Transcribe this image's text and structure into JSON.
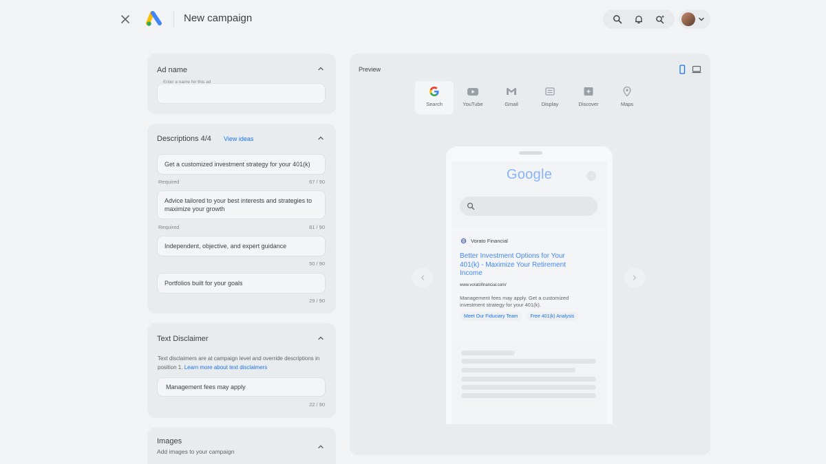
{
  "header": {
    "title": "New campaign"
  },
  "ad_name": {
    "title": "Ad name",
    "placeholder": "Enter a name for this ad"
  },
  "descriptions": {
    "title": "Descriptions 4/4",
    "view_ideas": "View ideas",
    "items": [
      {
        "text": "Get a customized investment strategy for your 401(k)",
        "helper": "Required",
        "count": "67 / 90"
      },
      {
        "text": "Advice tailored to your best interests and strategies to maximize your growth",
        "helper": "Required",
        "count": "81 / 90"
      },
      {
        "text": "Independent, objective, and expert guidance",
        "helper": "",
        "count": "50 / 90"
      },
      {
        "text": "Portfolios built for your goals",
        "helper": "",
        "count": "29 / 90"
      }
    ]
  },
  "text_disclaimer": {
    "title": "Text Disclaimer",
    "body_prefix": "Text disclaimers are at campaign level and override descriptions in position 1.",
    "learn_more": "Learn more about text disclaimers",
    "field_value": "Management fees may apply",
    "count": "22 / 90"
  },
  "images": {
    "title": "Images",
    "subtitle": "Add images to your campaign"
  },
  "preview": {
    "label": "Preview",
    "tabs": [
      {
        "label": "Search",
        "icon": "google-g-icon"
      },
      {
        "label": "YouTube",
        "icon": "youtube-icon"
      },
      {
        "label": "Gmail",
        "icon": "gmail-icon"
      },
      {
        "label": "Display",
        "icon": "display-icon"
      },
      {
        "label": "Discover",
        "icon": "discover-icon"
      },
      {
        "label": "Maps",
        "icon": "maps-pin-icon"
      }
    ],
    "active_tab": "Search",
    "phone": {
      "google_word": "Google",
      "advertiser": "Vorato Financial",
      "headline": "Better Investment Options for Your 401(k) - Maximize Your Retirement Income",
      "url": "www.voratofinancial.com/",
      "description": "Management fees may apply. Get a customized investment strategy for your 401(k).",
      "sitelinks": [
        "Meet Our Fiduciary Team",
        "Free 401(k) Analysis"
      ]
    }
  },
  "colors": {
    "background": "#f1f3f5",
    "card": "#e9ecef",
    "accent_blue": "#1a73e8",
    "headline_blue": "#4285f4"
  }
}
